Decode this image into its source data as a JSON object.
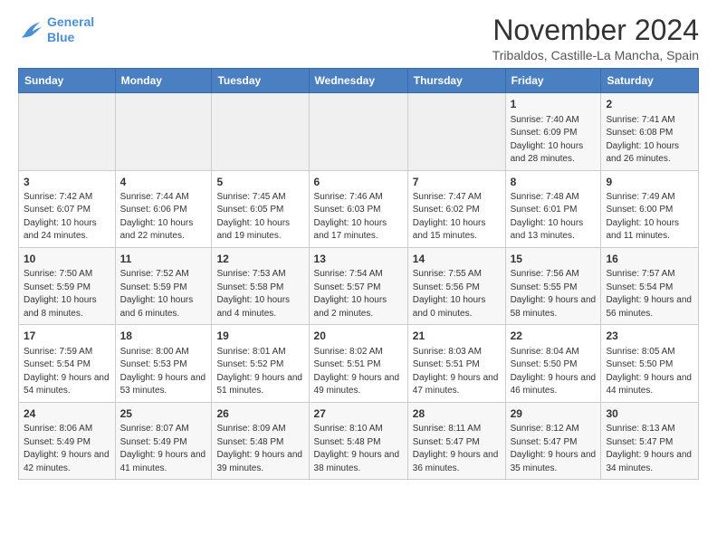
{
  "logo": {
    "line1": "General",
    "line2": "Blue"
  },
  "title": "November 2024",
  "subtitle": "Tribaldos, Castille-La Mancha, Spain",
  "headers": [
    "Sunday",
    "Monday",
    "Tuesday",
    "Wednesday",
    "Thursday",
    "Friday",
    "Saturday"
  ],
  "weeks": [
    [
      {
        "day": "",
        "empty": true
      },
      {
        "day": "",
        "empty": true
      },
      {
        "day": "",
        "empty": true
      },
      {
        "day": "",
        "empty": true
      },
      {
        "day": "",
        "empty": true
      },
      {
        "day": "1",
        "rise": "7:40 AM",
        "set": "6:09 PM",
        "daylight": "10 hours and 28 minutes."
      },
      {
        "day": "2",
        "rise": "7:41 AM",
        "set": "6:08 PM",
        "daylight": "10 hours and 26 minutes."
      }
    ],
    [
      {
        "day": "3",
        "rise": "7:42 AM",
        "set": "6:07 PM",
        "daylight": "10 hours and 24 minutes."
      },
      {
        "day": "4",
        "rise": "7:44 AM",
        "set": "6:06 PM",
        "daylight": "10 hours and 22 minutes."
      },
      {
        "day": "5",
        "rise": "7:45 AM",
        "set": "6:05 PM",
        "daylight": "10 hours and 19 minutes."
      },
      {
        "day": "6",
        "rise": "7:46 AM",
        "set": "6:03 PM",
        "daylight": "10 hours and 17 minutes."
      },
      {
        "day": "7",
        "rise": "7:47 AM",
        "set": "6:02 PM",
        "daylight": "10 hours and 15 minutes."
      },
      {
        "day": "8",
        "rise": "7:48 AM",
        "set": "6:01 PM",
        "daylight": "10 hours and 13 minutes."
      },
      {
        "day": "9",
        "rise": "7:49 AM",
        "set": "6:00 PM",
        "daylight": "10 hours and 11 minutes."
      }
    ],
    [
      {
        "day": "10",
        "rise": "7:50 AM",
        "set": "5:59 PM",
        "daylight": "10 hours and 8 minutes."
      },
      {
        "day": "11",
        "rise": "7:52 AM",
        "set": "5:59 PM",
        "daylight": "10 hours and 6 minutes."
      },
      {
        "day": "12",
        "rise": "7:53 AM",
        "set": "5:58 PM",
        "daylight": "10 hours and 4 minutes."
      },
      {
        "day": "13",
        "rise": "7:54 AM",
        "set": "5:57 PM",
        "daylight": "10 hours and 2 minutes."
      },
      {
        "day": "14",
        "rise": "7:55 AM",
        "set": "5:56 PM",
        "daylight": "10 hours and 0 minutes."
      },
      {
        "day": "15",
        "rise": "7:56 AM",
        "set": "5:55 PM",
        "daylight": "9 hours and 58 minutes."
      },
      {
        "day": "16",
        "rise": "7:57 AM",
        "set": "5:54 PM",
        "daylight": "9 hours and 56 minutes."
      }
    ],
    [
      {
        "day": "17",
        "rise": "7:59 AM",
        "set": "5:54 PM",
        "daylight": "9 hours and 54 minutes."
      },
      {
        "day": "18",
        "rise": "8:00 AM",
        "set": "5:53 PM",
        "daylight": "9 hours and 53 minutes."
      },
      {
        "day": "19",
        "rise": "8:01 AM",
        "set": "5:52 PM",
        "daylight": "9 hours and 51 minutes."
      },
      {
        "day": "20",
        "rise": "8:02 AM",
        "set": "5:51 PM",
        "daylight": "9 hours and 49 minutes."
      },
      {
        "day": "21",
        "rise": "8:03 AM",
        "set": "5:51 PM",
        "daylight": "9 hours and 47 minutes."
      },
      {
        "day": "22",
        "rise": "8:04 AM",
        "set": "5:50 PM",
        "daylight": "9 hours and 46 minutes."
      },
      {
        "day": "23",
        "rise": "8:05 AM",
        "set": "5:50 PM",
        "daylight": "9 hours and 44 minutes."
      }
    ],
    [
      {
        "day": "24",
        "rise": "8:06 AM",
        "set": "5:49 PM",
        "daylight": "9 hours and 42 minutes."
      },
      {
        "day": "25",
        "rise": "8:07 AM",
        "set": "5:49 PM",
        "daylight": "9 hours and 41 minutes."
      },
      {
        "day": "26",
        "rise": "8:09 AM",
        "set": "5:48 PM",
        "daylight": "9 hours and 39 minutes."
      },
      {
        "day": "27",
        "rise": "8:10 AM",
        "set": "5:48 PM",
        "daylight": "9 hours and 38 minutes."
      },
      {
        "day": "28",
        "rise": "8:11 AM",
        "set": "5:47 PM",
        "daylight": "9 hours and 36 minutes."
      },
      {
        "day": "29",
        "rise": "8:12 AM",
        "set": "5:47 PM",
        "daylight": "9 hours and 35 minutes."
      },
      {
        "day": "30",
        "rise": "8:13 AM",
        "set": "5:47 PM",
        "daylight": "9 hours and 34 minutes."
      }
    ]
  ]
}
